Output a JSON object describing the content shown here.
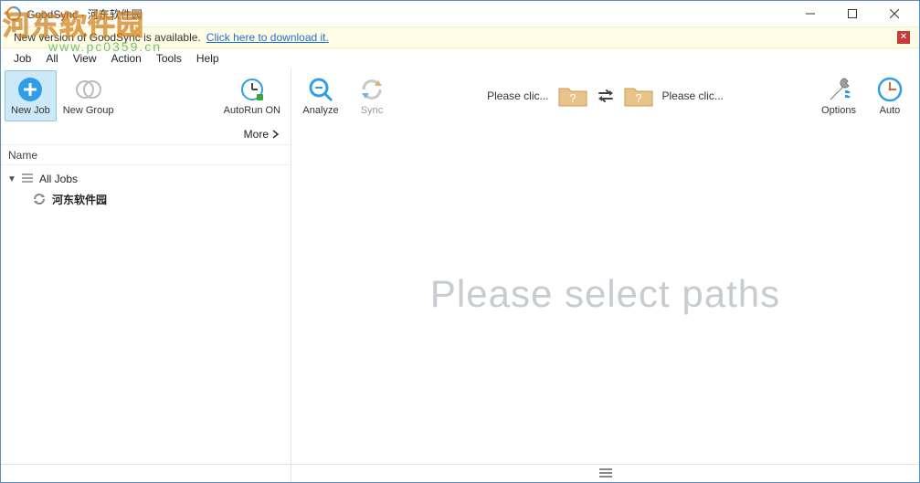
{
  "window": {
    "title": "GoodSync - 河东软件园"
  },
  "notify": {
    "text": "New version of GoodSync is available.",
    "link": "Click here to download it."
  },
  "menu": {
    "job": "Job",
    "all": "All",
    "view": "View",
    "action": "Action",
    "tools": "Tools",
    "help": "Help"
  },
  "toolbar": {
    "new_job": "New Job",
    "new_group": "New Group",
    "autorun": "AutoRun ON",
    "analyze": "Analyze",
    "sync": "Sync",
    "options": "Options",
    "auto": "Auto",
    "path_left": "Please clic...",
    "path_right": "Please clic..."
  },
  "side": {
    "more": "More",
    "name_header": "Name",
    "root": "All Jobs",
    "job1": "河东软件园"
  },
  "main": {
    "placeholder": "Please select paths"
  },
  "watermark": {
    "line1a": "河东",
    "line1b": "软件园",
    "line2": "www.pc0359.cn"
  },
  "colors": {
    "accent_blue": "#2e9fe6",
    "folder": "#e2b268"
  }
}
